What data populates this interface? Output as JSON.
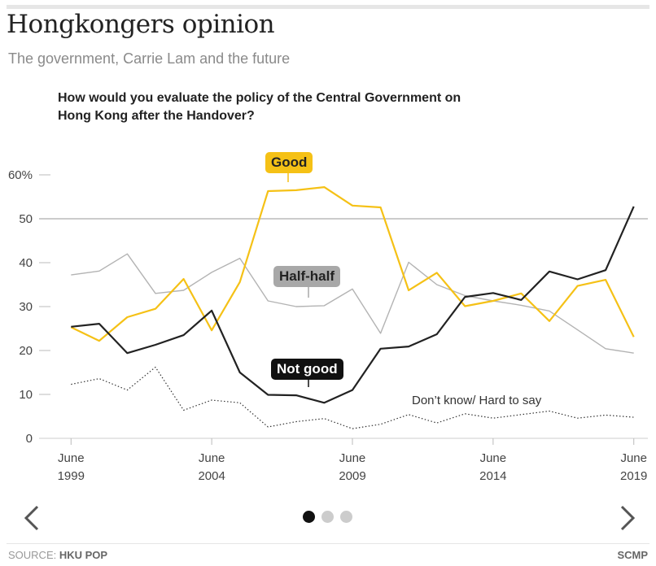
{
  "header": {
    "title": "Hongkongers opinion",
    "subtitle": "The government, Carrie Lam and the future"
  },
  "chart_data": {
    "type": "line",
    "title": "How would you evaluate the policy of the Central Government on Hong Kong after the Handover?",
    "xlabel": "",
    "ylabel": "",
    "ylim": [
      0,
      60
    ],
    "yticks": [
      0,
      10,
      20,
      30,
      40,
      50,
      60
    ],
    "ytick_labels": [
      "0",
      "10",
      "20",
      "30",
      "40",
      "50",
      "60%"
    ],
    "xticks": [
      {
        "x": 1999.5,
        "label": "June 1999"
      },
      {
        "x": 2004.5,
        "label": "June 2004"
      },
      {
        "x": 2009.5,
        "label": "June 2009"
      },
      {
        "x": 2014.5,
        "label": "June 2014"
      },
      {
        "x": 2019.5,
        "label": "June 2019"
      }
    ],
    "xlim": [
      1999.0,
      2020.0
    ],
    "x": [
      1999.5,
      2000.5,
      2001.5,
      2002.5,
      2003.5,
      2004.5,
      2005.5,
      2006.5,
      2007.5,
      2008.5,
      2009.5,
      2010.5,
      2011.5,
      2012.5,
      2013.5,
      2014.5,
      2015.5,
      2016.5,
      2017.5,
      2018.5,
      2019.5
    ],
    "grid": "reference line at 50",
    "series": [
      {
        "name": "Good",
        "color": "#f5c116",
        "values": [
          25.3,
          22.2,
          27.6,
          29.5,
          36.3,
          24.6,
          35.6,
          56.3,
          56.5,
          57.2,
          53.0,
          52.6,
          33.7,
          37.7,
          30.1,
          31.3,
          33.0,
          26.7,
          34.7,
          36.1,
          23.1
        ]
      },
      {
        "name": "Half-half",
        "color": "#b3b3b3",
        "values": [
          37.2,
          38.1,
          42.0,
          33.0,
          33.7,
          37.8,
          41.0,
          31.3,
          30.0,
          30.2,
          34.0,
          23.9,
          40.1,
          35.0,
          32.5,
          31.3,
          30.3,
          29.0,
          24.7,
          20.4,
          19.4
        ]
      },
      {
        "name": "Not good",
        "color": "#222222",
        "values": [
          25.4,
          26.1,
          19.4,
          21.3,
          23.5,
          29.1,
          15.0,
          9.9,
          9.8,
          8.1,
          11.0,
          20.4,
          20.9,
          23.7,
          32.2,
          33.1,
          31.5,
          38.0,
          36.2,
          38.3,
          52.8
        ]
      },
      {
        "name": "Don’t know/ Hard to say",
        "color": "#333333",
        "dotted": true,
        "values": [
          12.3,
          13.6,
          11.0,
          16.2,
          6.4,
          8.7,
          8.1,
          2.6,
          3.8,
          4.5,
          2.2,
          3.2,
          5.4,
          3.5,
          5.6,
          4.6,
          5.4,
          6.2,
          4.6,
          5.3,
          4.8
        ]
      }
    ]
  },
  "labels": {
    "good": "Good",
    "halfhalf": "Half-half",
    "notgood": "Not good",
    "dontknow": "Don’t know/ Hard to say"
  },
  "footer": {
    "source_prefix": "SOURCE: ",
    "source_name": "HKU POP",
    "brand": "SCMP"
  },
  "carousel": {
    "prev_icon": "chevron-left-icon",
    "next_icon": "chevron-right-icon",
    "active_index": 0,
    "dot_count": 3,
    "active_color": "#111111",
    "inactive_color": "#cccccc"
  }
}
